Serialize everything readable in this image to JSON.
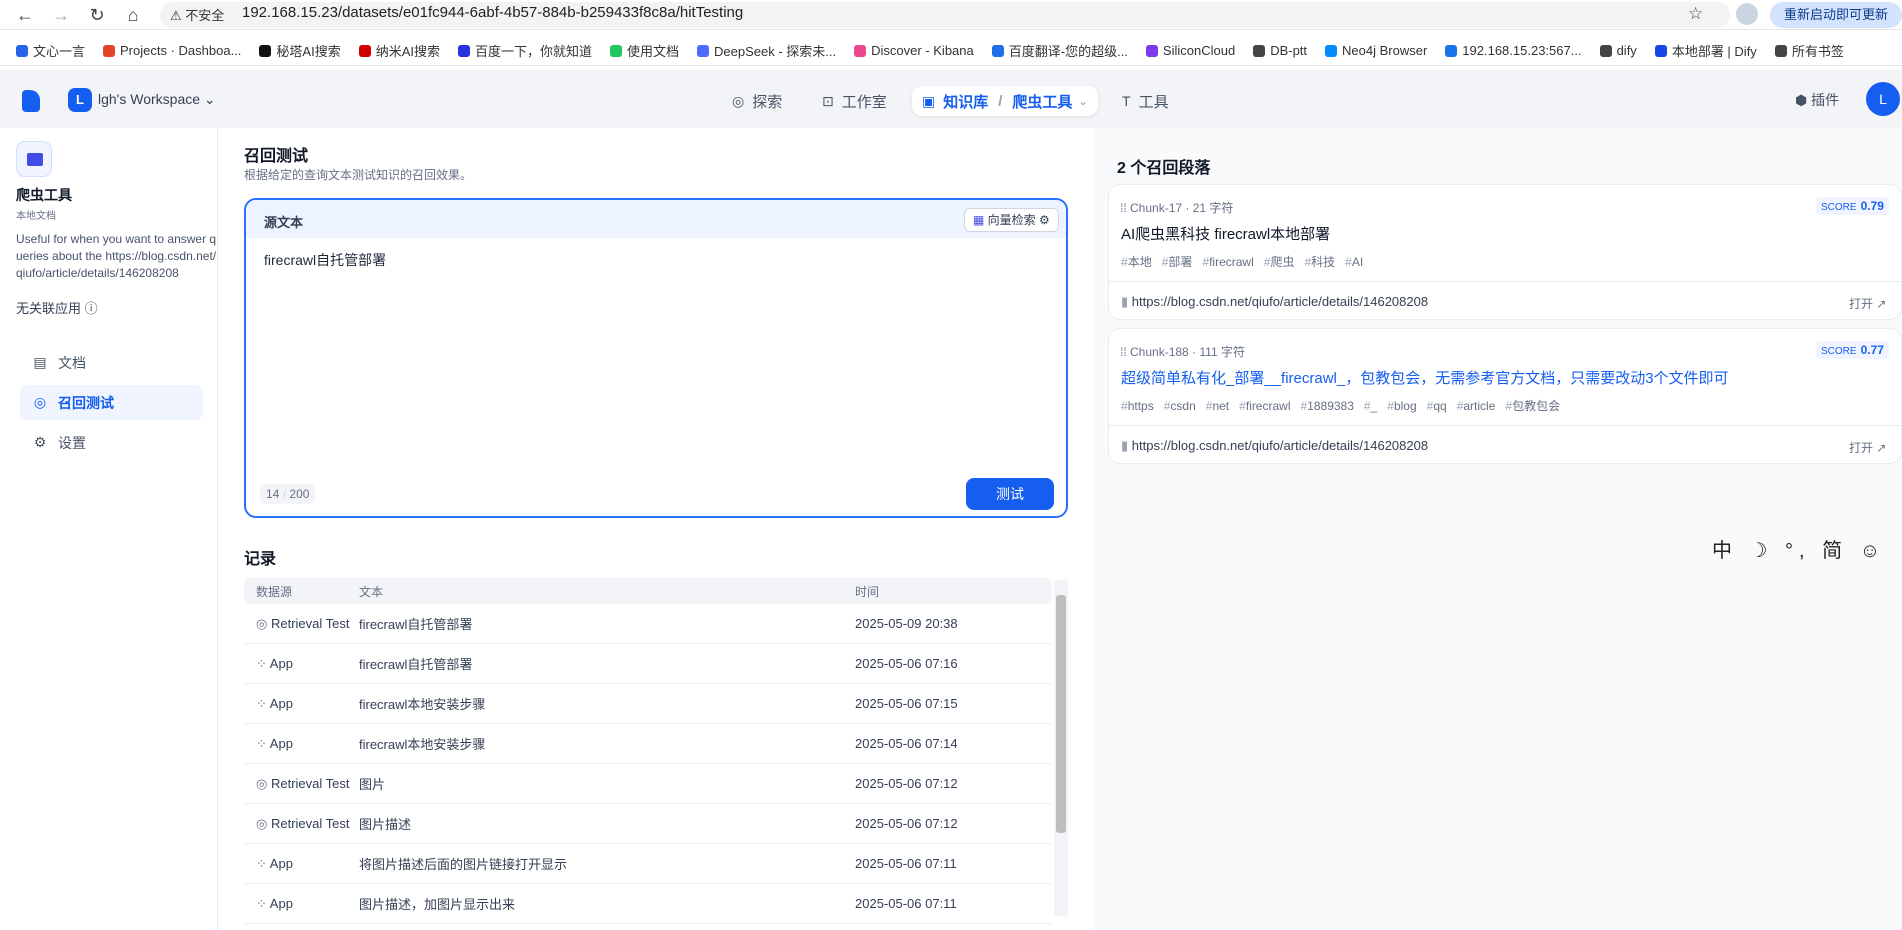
{
  "browser": {
    "insecure_label": "不安全",
    "url": "192.168.15.23/datasets/e01fc944-6abf-4b57-884b-b259433f8c8a/hitTesting",
    "update_label": "重新启动即可更新",
    "bookmarks": [
      "文心一言",
      "Projects · Dashboa...",
      "秘塔AI搜索",
      "纳米AI搜索",
      "百度一下，你就知道",
      "使用文档",
      "DeepSeek - 探索未...",
      "Discover - Kibana",
      "百度翻译-您的超级...",
      "SiliconCloud",
      "DB-ptt",
      "Neo4j Browser",
      "192.168.15.23:567...",
      "dify",
      "本地部署 | Dify",
      "所有书签"
    ]
  },
  "header": {
    "workspace_initial": "L",
    "workspace_name": "lgh's Workspace",
    "nav": {
      "explore": "探索",
      "studio": "工作室",
      "knowledge": "知识库",
      "dataset": "爬虫工具",
      "tools": "工具"
    },
    "plugins": "插件",
    "avatar": "L"
  },
  "sidebar": {
    "dataset_name": "爬虫工具",
    "dataset_sub": "本地文档",
    "description": "Useful for when you want to answer queries about the https://blog.csdn.net/qiufo/article/details/146208208",
    "unlinked": "无关联应用",
    "items": [
      {
        "label": "文档"
      },
      {
        "label": "召回测试"
      },
      {
        "label": "设置"
      }
    ]
  },
  "main": {
    "title": "召回测试",
    "subtitle": "根据给定的查询文本测试知识的召回效果。",
    "source_label": "源文本",
    "vector_search": "向量检索",
    "query_text": "firecrawl自托管部署",
    "char_count": "14",
    "char_limit": "200",
    "test_button": "测试",
    "records_title": "记录",
    "columns": [
      "数据源",
      "文本",
      "时间"
    ],
    "records": [
      {
        "source": "Retrieval Test",
        "text": "firecrawl自托管部署",
        "time": "2025-05-09 20:38"
      },
      {
        "source": "App",
        "text": "firecrawl自托管部署",
        "time": "2025-05-06 07:16"
      },
      {
        "source": "App",
        "text": "firecrawl本地安装步骤",
        "time": "2025-05-06 07:15"
      },
      {
        "source": "App",
        "text": "firecrawl本地安装步骤",
        "time": "2025-05-06 07:14"
      },
      {
        "source": "Retrieval Test",
        "text": "图片",
        "time": "2025-05-06 07:12"
      },
      {
        "source": "Retrieval Test",
        "text": "图片描述",
        "time": "2025-05-06 07:12"
      },
      {
        "source": "App",
        "text": "将图片描述后面的图片链接打开显示",
        "time": "2025-05-06 07:11"
      },
      {
        "source": "App",
        "text": "图片描述，加图片显示出来",
        "time": "2025-05-06 07:11"
      }
    ]
  },
  "results": {
    "title": "2 个召回段落",
    "chunks": [
      {
        "meta": "Chunk-17 · 21 字符",
        "score_label": "SCORE",
        "score": "0.79",
        "content": "AI爬虫黑科技 firecrawl本地部署",
        "tags": [
          "本地",
          "部署",
          "firecrawl",
          "爬虫",
          "科技",
          "AI"
        ],
        "source": "https://blog.csdn.net/qiufo/article/details/146208208",
        "open": "打开 ↗",
        "color": "#101828"
      },
      {
        "meta": "Chunk-188 · 111 字符",
        "score_label": "SCORE",
        "score": "0.77",
        "content": "超级简单私有化_部署__firecrawl_，包教包会，无需参考官方文档，只需要改动3个文件即可",
        "tags": [
          "https",
          "csdn",
          "net",
          "firecrawl",
          "1889383",
          "_",
          "blog",
          "qq",
          "article",
          "包教包会"
        ],
        "source": "https://blog.csdn.net/qiufo/article/details/146208208",
        "open": "打开 ↗",
        "color": "#155eef"
      }
    ]
  },
  "ime": "中 ☽ °, 简 ☺"
}
